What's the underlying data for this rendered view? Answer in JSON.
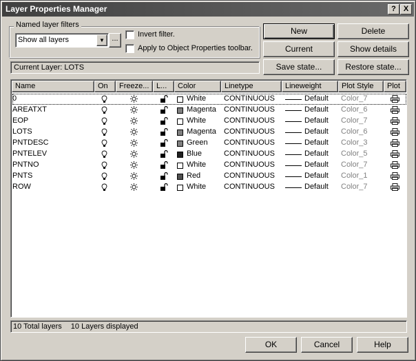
{
  "window": {
    "title": "Layer Properties Manager"
  },
  "title_buttons": {
    "help": "?",
    "close": "X"
  },
  "filters": {
    "group_label": "Named layer filters",
    "combo_value": "Show all layers",
    "more_label": "...",
    "invert_label": "Invert filter.",
    "apply_label": "Apply to Object Properties toolbar."
  },
  "buttons": {
    "new": "New",
    "delete": "Delete",
    "current": "Current",
    "show_details": "Show details",
    "save_state": "Save state...",
    "restore_state": "Restore state...",
    "ok": "OK",
    "cancel": "Cancel",
    "help": "Help"
  },
  "current_layer": "Current Layer:  LOTS",
  "table": {
    "headers": [
      "Name",
      "On",
      "Freeze...",
      "L...",
      "Color",
      "Linetype",
      "Lineweight",
      "Plot Style",
      "Plot"
    ],
    "rows": [
      {
        "name": "0",
        "color": "White",
        "swatch": "#ffffff",
        "linetype": "CONTINUOUS",
        "lineweight": "Default",
        "plot_style": "Color_7"
      },
      {
        "name": "AREATXT",
        "color": "Magenta",
        "swatch": "#808080",
        "linetype": "CONTINUOUS",
        "lineweight": "Default",
        "plot_style": "Color_6"
      },
      {
        "name": "EOP",
        "color": "White",
        "swatch": "#ffffff",
        "linetype": "CONTINUOUS",
        "lineweight": "Default",
        "plot_style": "Color_7"
      },
      {
        "name": "LOTS",
        "color": "Magenta",
        "swatch": "#808080",
        "linetype": "CONTINUOUS",
        "lineweight": "Default",
        "plot_style": "Color_6"
      },
      {
        "name": "PNTDESC",
        "color": "Green",
        "swatch": "#808080",
        "linetype": "CONTINUOUS",
        "lineweight": "Default",
        "plot_style": "Color_3"
      },
      {
        "name": "PNTELEV",
        "color": "Blue",
        "swatch": "#202020",
        "linetype": "CONTINUOUS",
        "lineweight": "Default",
        "plot_style": "Color_5"
      },
      {
        "name": "PNTNO",
        "color": "White",
        "swatch": "#ffffff",
        "linetype": "CONTINUOUS",
        "lineweight": "Default",
        "plot_style": "Color_7"
      },
      {
        "name": "PNTS",
        "color": "Red",
        "swatch": "#505050",
        "linetype": "CONTINUOUS",
        "lineweight": "Default",
        "plot_style": "Color_1"
      },
      {
        "name": "ROW",
        "color": "White",
        "swatch": "#ffffff",
        "linetype": "CONTINUOUS",
        "lineweight": "Default",
        "plot_style": "Color_7"
      }
    ]
  },
  "status": {
    "total": "10 Total layers",
    "displayed": "10 Layers displayed"
  },
  "icons": {
    "on": "lightbulb-icon",
    "freeze": "sun-icon",
    "lock": "unlocked-padlock-icon",
    "plot": "printer-icon"
  }
}
